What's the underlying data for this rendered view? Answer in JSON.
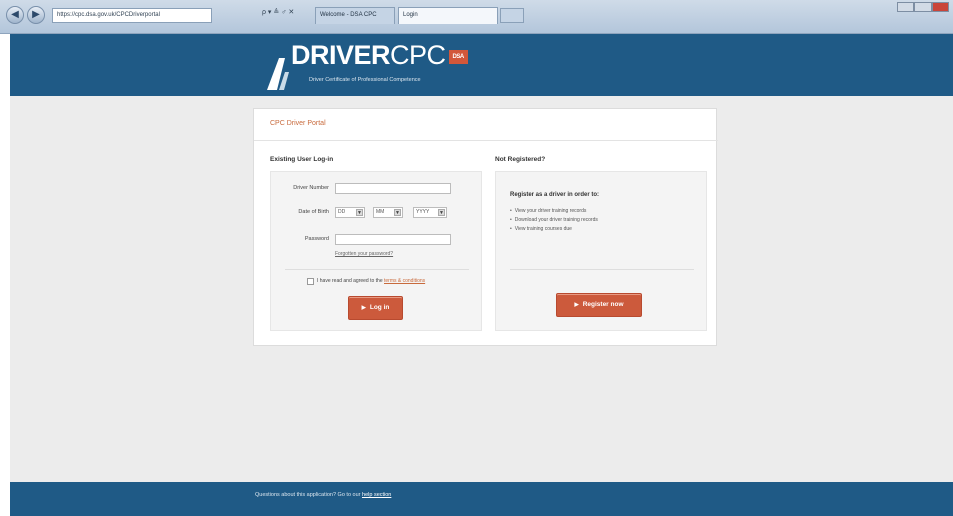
{
  "browser": {
    "address": "https://cpc.dsa.gov.uk/CPCDriverportal",
    "address_tools": "ρ ▾ ≜ ♂ ✕",
    "tabs": [
      {
        "label": "Welcome - DSA CPC"
      },
      {
        "label": "Login"
      }
    ],
    "right_tools": ""
  },
  "header": {
    "logo_bold": "DRIVER",
    "logo_rest": "CPC",
    "logo_badge": "DSA",
    "tagline": "Driver Certificate of Professional Competence"
  },
  "portal": {
    "title": "CPC Driver Portal"
  },
  "login": {
    "heading": "Existing User Log-in",
    "driver_number_label": "Driver Number",
    "driver_number_value": "",
    "dob_label": "Date of Birth",
    "dob_day": "DD",
    "dob_month": "MM",
    "dob_year": "YYYY",
    "password_label": "Password",
    "password_value": "",
    "forgot_link": "Forgotten your password?",
    "agree_prefix": "I have read and agreed to the ",
    "agree_link": "terms & conditions",
    "login_button": "Log in"
  },
  "register": {
    "heading": "Not Registered?",
    "intro": "Register as a driver in order to:",
    "items": [
      "View your driver training records",
      "Download your driver training records",
      "View training courses due"
    ],
    "register_button": "Register now"
  },
  "footer": {
    "text": "Questions about this application? Go to our ",
    "link": "help section"
  }
}
